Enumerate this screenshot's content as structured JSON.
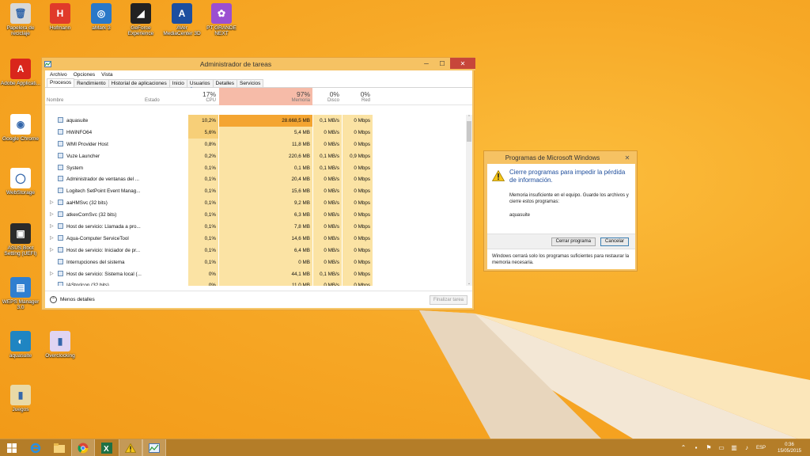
{
  "desktop": {
    "icons": [
      {
        "label": "Papelera de reciclaje",
        "icon": "recycle-bin-icon",
        "color": "#d8d8d8",
        "glyph": "🗑"
      },
      {
        "label": "Hofmann",
        "icon": "app-red-icon",
        "color": "#e03a2a",
        "glyph": "H"
      },
      {
        "label": "aMark 3",
        "icon": "globe-blue-icon",
        "color": "#2a78c8",
        "glyph": "◎"
      },
      {
        "label": "GeForce Experience",
        "icon": "nvidia-icon",
        "color": "#222222",
        "glyph": "◢"
      },
      {
        "label": "AVer MediaCenter 3D",
        "icon": "aver-icon",
        "color": "#1d4fa0",
        "glyph": "A"
      },
      {
        "label": "PT GRANDE NEXT",
        "icon": "flower-icon",
        "color": "#9b4fd1",
        "glyph": "✿"
      },
      {
        "label": "Adobe Applicati...",
        "icon": "adobe-icon",
        "color": "#d9261c",
        "glyph": "A"
      },
      {
        "label": "Google Chrome",
        "icon": "chrome-icon",
        "color": "#ffffff",
        "glyph": "◉"
      },
      {
        "label": "WebStorage",
        "icon": "webstorage-icon",
        "color": "#ffffff",
        "glyph": "◯"
      },
      {
        "label": "ASUS Boot Setting (UEFI)",
        "icon": "asus-icon",
        "color": "#2b2b2b",
        "glyph": "▣"
      },
      {
        "label": "WEPS Manager 3.0",
        "icon": "weps-icon",
        "color": "#2f7fd0",
        "glyph": "▤"
      },
      {
        "label": "aquasuite",
        "icon": "aquasuite-icon",
        "color": "#1f85c2",
        "glyph": "◐"
      },
      {
        "label": "Overclocking",
        "icon": "overclocking-icon",
        "color": "#e0d4f2",
        "glyph": "▮"
      },
      {
        "label": "Juegos",
        "icon": "games-icon",
        "color": "#e9d9a6",
        "glyph": "▮"
      }
    ]
  },
  "taskmanager": {
    "title": "Administrador de tareas",
    "menus": [
      "Archivo",
      "Opciones",
      "Vista"
    ],
    "tabs": [
      "Procesos",
      "Rendimiento",
      "Historial de aplicaciones",
      "Inicio",
      "Usuarios",
      "Detalles",
      "Servicios"
    ],
    "columns": {
      "name": "Nombre",
      "status": "Estado",
      "cpu_pct": "17%",
      "cpu": "CPU",
      "mem_pct": "97%",
      "mem": "Memoria",
      "disk_pct": "0%",
      "disk": "Disco",
      "net_pct": "0%",
      "net": "Red"
    },
    "processes": [
      {
        "name": "aquasuite",
        "cpu": "10,2%",
        "mem": "28.668,5 MB",
        "disk": "0,1 MB/s",
        "net": "0 Mbps",
        "expandable": false
      },
      {
        "name": "HWiNFO64",
        "cpu": "5,6%",
        "mem": "5,4 MB",
        "disk": "0 MB/s",
        "net": "0 Mbps",
        "expandable": false
      },
      {
        "name": "WMI Provider Host",
        "cpu": "0,8%",
        "mem": "11,8 MB",
        "disk": "0 MB/s",
        "net": "0 Mbps",
        "expandable": false
      },
      {
        "name": "Vuze Launcher",
        "cpu": "0,2%",
        "mem": "220,6 MB",
        "disk": "0,1 MB/s",
        "net": "0,9 Mbps",
        "expandable": false
      },
      {
        "name": "System",
        "cpu": "0,1%",
        "mem": "0,1 MB",
        "disk": "0,1 MB/s",
        "net": "0 Mbps",
        "expandable": false
      },
      {
        "name": "Administrador de ventanas del ...",
        "cpu": "0,1%",
        "mem": "20,4 MB",
        "disk": "0 MB/s",
        "net": "0 Mbps",
        "expandable": false
      },
      {
        "name": "Logitech SetPoint Event Manag...",
        "cpu": "0,1%",
        "mem": "15,6 MB",
        "disk": "0 MB/s",
        "net": "0 Mbps",
        "expandable": false
      },
      {
        "name": "aaHMSvc (32 bits)",
        "cpu": "0,1%",
        "mem": "9,2 MB",
        "disk": "0 MB/s",
        "net": "0 Mbps",
        "expandable": true
      },
      {
        "name": "atkexComSvc (32 bits)",
        "cpu": "0,1%",
        "mem": "6,3 MB",
        "disk": "0 MB/s",
        "net": "0 Mbps",
        "expandable": true
      },
      {
        "name": "Host de servicio: Llamada a pro...",
        "cpu": "0,1%",
        "mem": "7,8 MB",
        "disk": "0 MB/s",
        "net": "0 Mbps",
        "expandable": true
      },
      {
        "name": "Aqua-Computer ServiceTool",
        "cpu": "0,1%",
        "mem": "14,6 MB",
        "disk": "0 MB/s",
        "net": "0 Mbps",
        "expandable": true
      },
      {
        "name": "Host de servicio: Iniciador de pr...",
        "cpu": "0,1%",
        "mem": "6,4 MB",
        "disk": "0 MB/s",
        "net": "0 Mbps",
        "expandable": true
      },
      {
        "name": "Interrupciones del sistema",
        "cpu": "0,1%",
        "mem": "0 MB",
        "disk": "0 MB/s",
        "net": "0 Mbps",
        "expandable": false
      },
      {
        "name": "Host de servicio: Sistema local (...",
        "cpu": "0%",
        "mem": "44,1 MB",
        "disk": "0,1 MB/s",
        "net": "0 Mbps",
        "expandable": true
      },
      {
        "name": "IAStorIcon (32 bits)",
        "cpu": "0%",
        "mem": "11,0 MB",
        "disk": "0 MB/s",
        "net": "0 Mbps",
        "expandable": false
      }
    ],
    "fewer_details": "Menos detalles",
    "end_task": "Finalizar tarea"
  },
  "dialog": {
    "title": "Programas de Microsoft Windows",
    "heading": "Cierre programas para impedir la pérdida de información.",
    "message": "Memoria insuficiente en el equipo. Guarde los archivos y cierre estos programas:",
    "app": "aquasuite",
    "close_programs": "Cerrar programa",
    "cancel": "Cancelar",
    "footer": "Windows cerrará solo los programas suficientes para restaurar la memoria necesaria."
  },
  "taskbar": {
    "apps": [
      "start-icon",
      "ie-icon",
      "explorer-icon",
      "chrome-icon",
      "excel-icon",
      "warning-icon",
      "taskmanager-icon"
    ],
    "language": "ESP",
    "time": "0:36",
    "date": "15/05/2015"
  },
  "colors": {
    "desktop_bg": "#f6a723",
    "cpu_heat": "#fbe3a4",
    "mem_heat": "#f4a531",
    "mem_header_heat": "#f6bba8",
    "accent_blue": "#1e4d9b"
  }
}
